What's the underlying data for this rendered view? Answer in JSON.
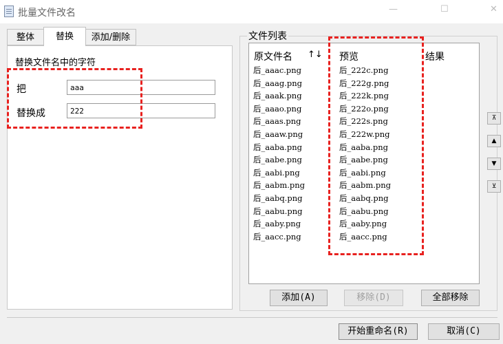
{
  "window": {
    "title": "批量文件改名",
    "minimize_glyph": "—",
    "maximize_glyph": "☐",
    "close_glyph": "✕"
  },
  "tabs": [
    {
      "label": "整体",
      "active": false
    },
    {
      "label": "替换",
      "active": true
    },
    {
      "label": "添加/删除",
      "active": false
    }
  ],
  "replace_panel": {
    "group_title": "替换文件名中的字符",
    "find_label": "把",
    "find_value": "aaa",
    "replace_label": "替换成",
    "replace_value": "222"
  },
  "file_list": {
    "group_title": "文件列表",
    "columns": {
      "original": "原文件名",
      "sort_glyph": "↑↓",
      "preview": "预览",
      "result": "结果"
    },
    "original": [
      "后_aaac.png",
      "后_aaag.png",
      "后_aaak.png",
      "后_aaao.png",
      "后_aaas.png",
      "后_aaaw.png",
      "后_aaba.png",
      "后_aabe.png",
      "后_aabi.png",
      "后_aabm.png",
      "后_aabq.png",
      "后_aabu.png",
      "后_aaby.png",
      "后_aacc.png"
    ],
    "preview": [
      "后_222c.png",
      "后_222g.png",
      "后_222k.png",
      "后_222o.png",
      "后_222s.png",
      "后_222w.png",
      "后_aaba.png",
      "后_aabe.png",
      "后_aabi.png",
      "后_aabm.png",
      "后_aabq.png",
      "后_aabu.png",
      "后_aaby.png",
      "后_aacc.png"
    ]
  },
  "side_buttons": {
    "top": "⊼",
    "up": "▲",
    "down": "▼",
    "bottom": "⊻"
  },
  "list_buttons": {
    "add": "添加(A)",
    "remove": "移除(D)",
    "remove_all": "全部移除"
  },
  "footer_buttons": {
    "start": "开始重命名(R)",
    "cancel": "取消(C)"
  },
  "colors": {
    "highlight_red": "#e8211f",
    "background": "#f0f0f0"
  }
}
